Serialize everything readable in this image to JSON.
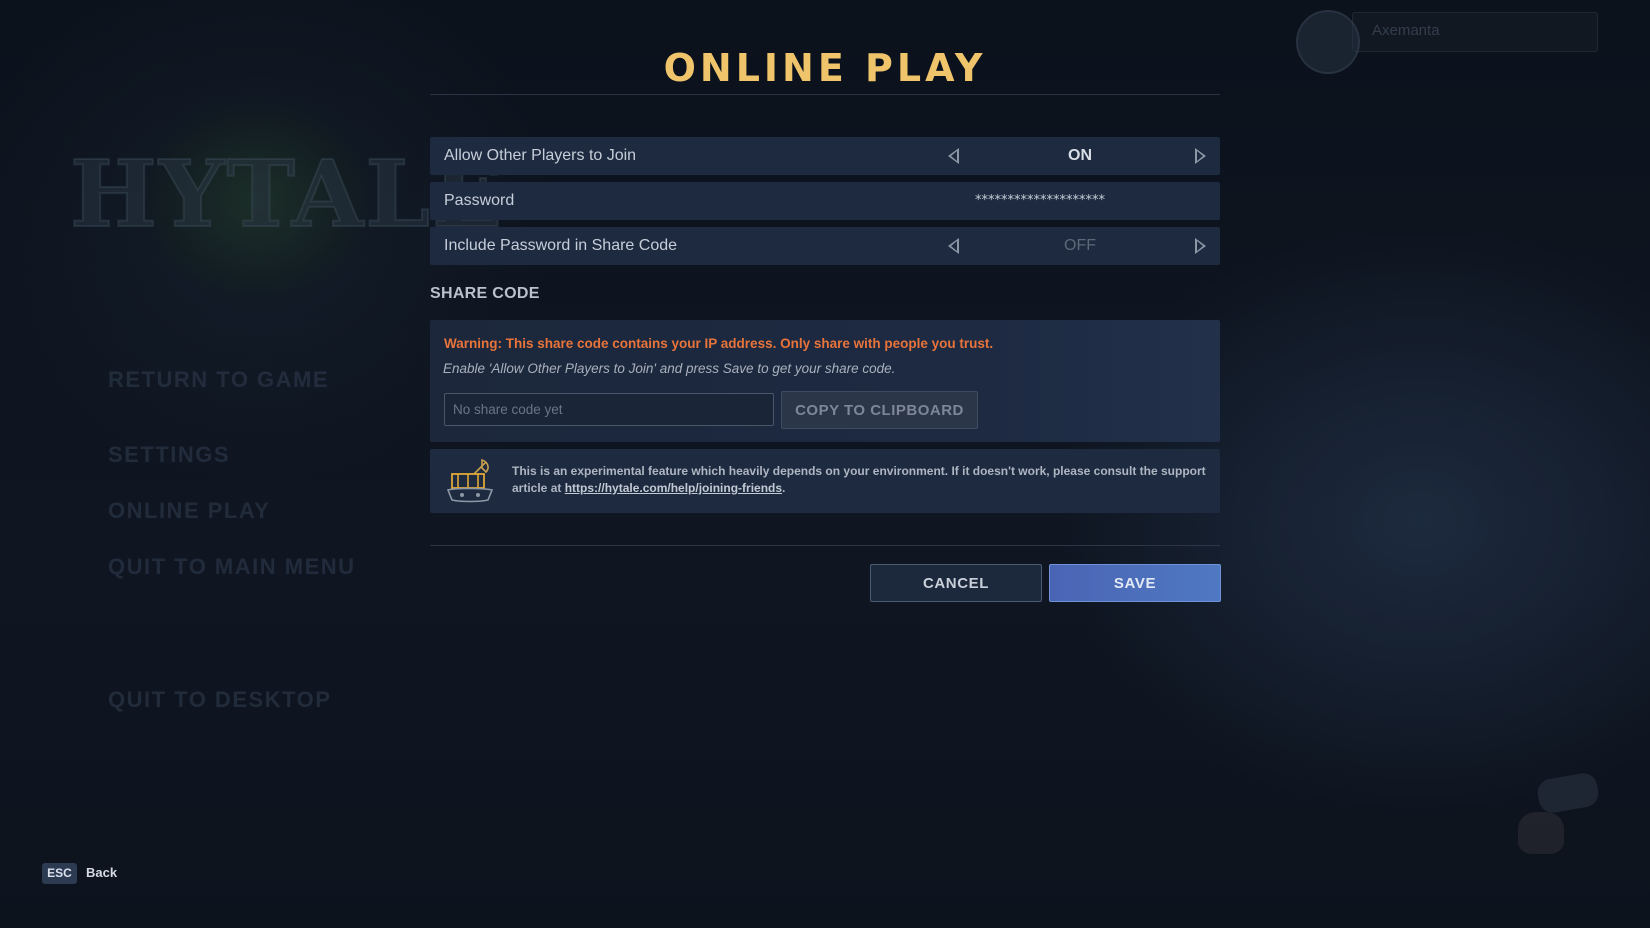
{
  "background_menu": {
    "logo_text": "HYTALE",
    "items": [
      "RETURN TO GAME",
      "SETTINGS",
      "ONLINE PLAY",
      "QUIT TO MAIN MENU",
      "QUIT TO DESKTOP"
    ],
    "username": "Axemanta"
  },
  "dialog": {
    "title": "ONLINE PLAY",
    "settings": [
      {
        "label": "Allow Other Players to Join",
        "value": "ON"
      },
      {
        "label": "Password",
        "value": "********************"
      },
      {
        "label": "Include Password in Share Code",
        "value": "OFF"
      }
    ],
    "share_code": {
      "section_title": "SHARE CODE",
      "warning": "Warning: This share code contains your IP address. Only share with people you trust.",
      "hint": "Enable 'Allow Other Players to Join' and press Save to get your share code.",
      "input_placeholder": "No share code yet",
      "input_value": "",
      "copy_label": "COPY TO CLIPBOARD"
    },
    "info": {
      "text": "This is an experimental feature which heavily depends on your environment. If it doesn't work, please consult the support article at ",
      "link": "https://hytale.com/help/joining-friends",
      "suffix": "."
    },
    "buttons": {
      "cancel": "CANCEL",
      "save": "SAVE"
    }
  },
  "footer": {
    "key": "ESC",
    "label": "Back"
  },
  "colors": {
    "title": "#f0c46a",
    "warning": "#e8743b",
    "row_bg": "#1d2a40",
    "save_button": "#4f79c2"
  }
}
